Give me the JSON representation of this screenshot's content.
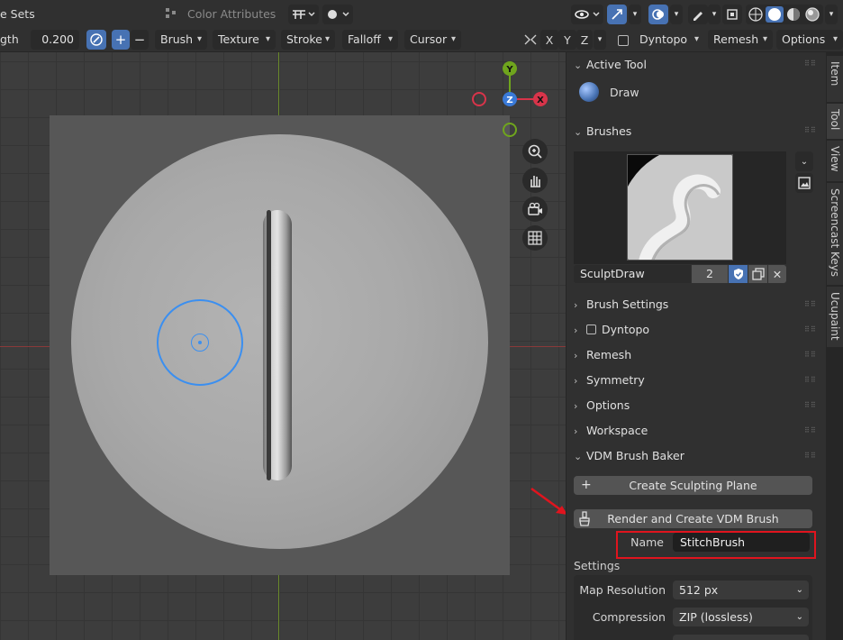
{
  "header": {
    "face_sets_label": "e Sets",
    "color_attributes_label": "Color Attributes",
    "strength_label": "gth",
    "strength_value": "0.200",
    "brush_menu": "Brush",
    "texture_menu": "Texture",
    "stroke_menu": "Stroke",
    "falloff_menu": "Falloff",
    "cursor_menu": "Cursor",
    "axis_x": "X",
    "axis_y": "Y",
    "axis_z": "Z",
    "dyntopo_menu": "Dyntopo",
    "remesh_menu": "Remesh",
    "options_menu": "Options"
  },
  "gizmo": {
    "x": "X",
    "y": "Y",
    "z": "Z"
  },
  "panel": {
    "active_tool": {
      "title": "Active Tool",
      "tool_name": "Draw"
    },
    "brushes": {
      "title": "Brushes",
      "brush_name": "SculptDraw",
      "users": "2"
    },
    "sections": [
      "Brush Settings",
      "Dyntopo",
      "Remesh",
      "Symmetry",
      "Options",
      "Workspace"
    ],
    "vdm": {
      "title": "VDM Brush Baker",
      "create_plane_label": "Create Sculpting Plane",
      "render_create_label": "Render and Create VDM Brush",
      "name_label": "Name",
      "name_value": "StitchBrush",
      "settings_label": "Settings",
      "map_resolution_label": "Map Resolution",
      "map_resolution_value": "512 px",
      "compression_label": "Compression",
      "compression_value": "ZIP (lossless)"
    }
  },
  "tabs": [
    "Item",
    "Tool",
    "View",
    "Screencast Keys",
    "Ucupaint"
  ],
  "colors": {
    "annotation_red": "#e0141e",
    "accent_blue": "#4772b3",
    "brush_cursor": "#3b8ff0"
  }
}
